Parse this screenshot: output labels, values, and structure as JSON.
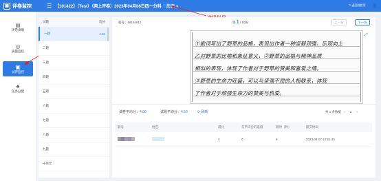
{
  "app": {
    "name": "评卷监控"
  },
  "header": {
    "exam_title": "【101422】（Test）（网上评卷）2023年04月06日四一分科",
    "history": "历史",
    "right_link": "返回到首页",
    "user_icon": "user-icon"
  },
  "annotation": {
    "text": "选择科目",
    "color": "#e02020"
  },
  "sidebar": {
    "items": [
      {
        "label": "评卷详情",
        "icon": "doc-icon"
      },
      {
        "label": "质量监控",
        "icon": "target-icon"
      },
      {
        "label": "试评监控",
        "icon": "monitor-icon"
      },
      {
        "label": "任务分配",
        "icon": "tree-icon"
      }
    ]
  },
  "questions": {
    "header": {
      "col1": "试题",
      "col2": "均分"
    },
    "rows": [
      {
        "name": "一题",
        "score": "4.50"
      },
      {
        "name": "二题",
        "score": ""
      },
      {
        "name": "三题",
        "score": ""
      },
      {
        "name": "四题",
        "score": ""
      },
      {
        "name": "五题",
        "score": ""
      },
      {
        "name": "六题",
        "score": ""
      },
      {
        "name": "七题",
        "score": ""
      },
      {
        "name": "八题",
        "score": ""
      },
      {
        "name": "九题",
        "score": ""
      },
      {
        "name": "十作文",
        "score": ""
      }
    ]
  },
  "paper": {
    "number_label": "密号：56154612",
    "page_current": "1",
    "page_total": "/ 10份",
    "prev_label": "上一份",
    "next_label": "下一份",
    "handwriting": [
      "①歌词写出了野草的品格，表现出作者一种坚毅顽强、乐观向上",
      "乙对野草的比喻和象征意义，②野草的品格与精神品质",
      "相似的表现，体现了作者对于野草的赞美和喜爱之情。",
      "③野草的生命力旺盛，可以与坚强不屈的人相联系，体现",
      "了作者对于顽强生命力的赞美与热爱。"
    ]
  },
  "stats": {
    "paper_avg_label": "试卷平均分：",
    "paper_avg": "4.00",
    "question_avg_label": "试题平均分：",
    "question_avg": "4.50",
    "refresh": "刷新",
    "total_label": "共 1 条数据",
    "page": "1"
  },
  "table": {
    "headers": [
      "题号",
      "姓名",
      "得分",
      "与平均分的差值",
      "耗时（秒）",
      "提交时间"
    ],
    "rows": [
      {
        "id": "",
        "name": "",
        "score": "4",
        "diff": "0",
        "time": "6",
        "submitted": "2023-04-07 10:51:43"
      }
    ]
  },
  "colors": {
    "primary": "#2f7be6",
    "annotation": "#e02020"
  }
}
